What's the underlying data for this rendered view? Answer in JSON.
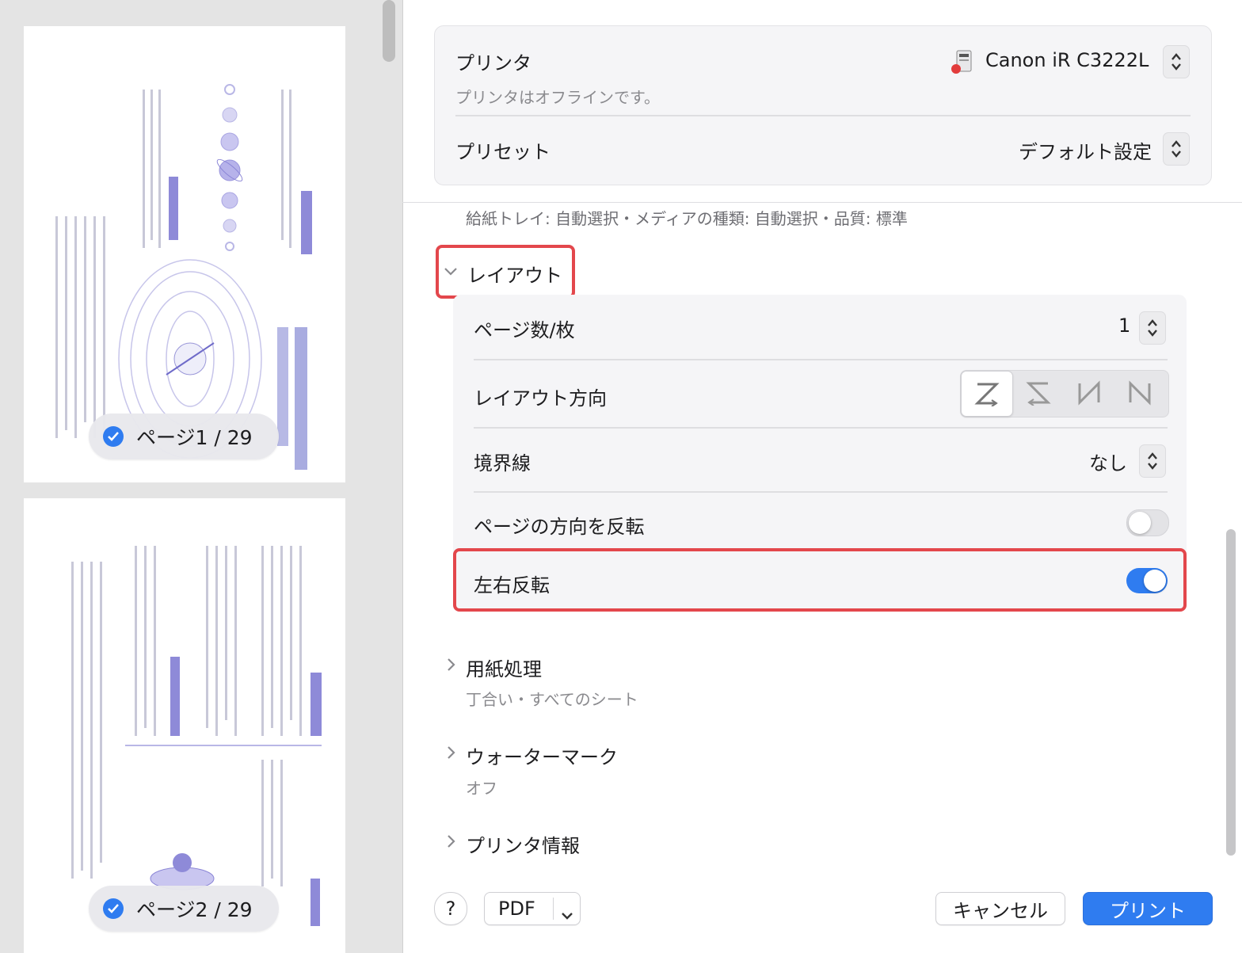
{
  "preview": {
    "pages": [
      {
        "label": "ページ1 / 29",
        "checked": true
      },
      {
        "label": "ページ2 / 29",
        "checked": true
      }
    ]
  },
  "printer": {
    "label": "プリンタ",
    "name": "Canon iR C3222L",
    "status": "プリンタはオフラインです。"
  },
  "preset": {
    "label": "プリセット",
    "value": "デフォルト設定"
  },
  "summary": "給紙トレイ: 自動選択・メディアの種類: 自動選択・品質: 標準",
  "layout": {
    "header": "レイアウト",
    "expanded": true,
    "pages_per_sheet": {
      "label": "ページ数/枚",
      "value": "1"
    },
    "direction": {
      "label": "レイアウト方向",
      "options": [
        "Z-icon",
        "reverse-Z-icon",
        "reverse-N-icon",
        "N-icon"
      ],
      "selected": 0
    },
    "border": {
      "label": "境界線",
      "value": "なし"
    },
    "reverse_orientation": {
      "label": "ページの方向を反転",
      "on": false
    },
    "flip_horizontal": {
      "label": "左右反転",
      "on": true
    }
  },
  "sections": [
    {
      "title": "用紙処理",
      "subtitle": "丁合い・すべてのシート"
    },
    {
      "title": "ウォーターマーク",
      "subtitle": "オフ"
    },
    {
      "title": "プリンタ情報",
      "subtitle": ""
    }
  ],
  "footer": {
    "help": "?",
    "pdf": "PDF",
    "cancel": "キャンセル",
    "print": "プリント"
  },
  "colors": {
    "accent": "#2f7cf0",
    "highlight": "#e3474c",
    "toggle_on": "#2f7cf0",
    "toggle_off": "#e3e3e6"
  }
}
